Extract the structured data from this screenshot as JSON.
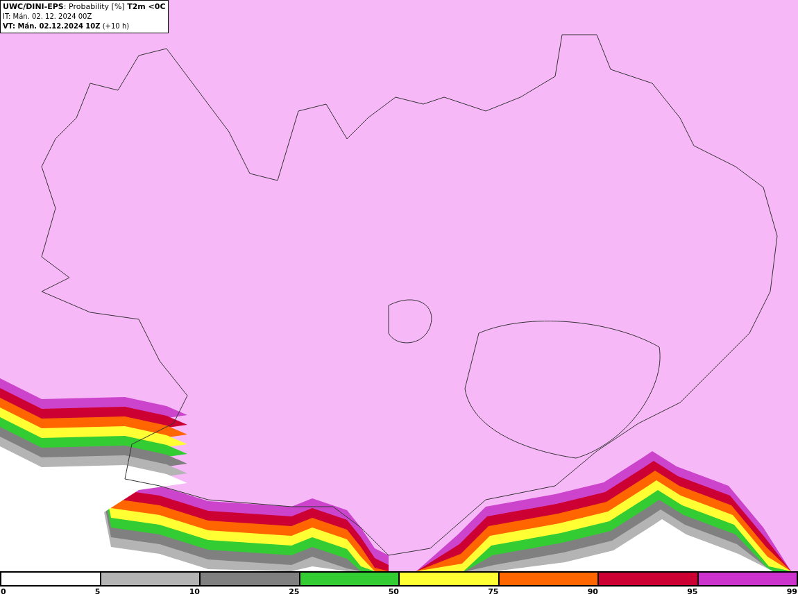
{
  "title": {
    "line1": "**UWC/DINI-EPS**: Probability [%] **T2m <0C**",
    "line2": "IT: Mán. 02. 12. 2024 00Z",
    "line3": "**VT: Mán. 02.12.2024 10Z** (+10 h)"
  },
  "legend": {
    "segments": [
      {
        "color": "#ffffff"
      },
      {
        "color": "#b4b4b4"
      },
      {
        "color": "#808080"
      },
      {
        "color": "#33cc33"
      },
      {
        "color": "#ffff33"
      },
      {
        "color": "#ff6600"
      },
      {
        "color": "#cc0033"
      },
      {
        "color": "#cc33cc"
      }
    ],
    "labels": [
      "0",
      "5",
      "10",
      "25",
      "50",
      "75",
      "90",
      "95",
      "99"
    ]
  }
}
